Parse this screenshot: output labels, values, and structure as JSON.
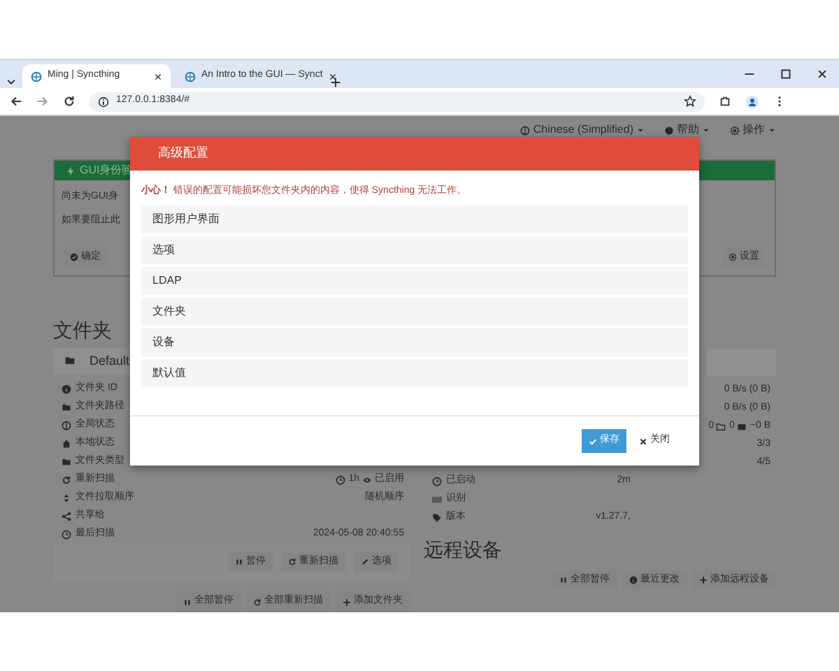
{
  "browser": {
    "tabs": [
      {
        "title": "Ming | Syncthing",
        "selected": true
      },
      {
        "title": "An Intro to the GUI — Synct",
        "selected": false
      }
    ],
    "address": "127.0.0.1:8384/#"
  },
  "navbar": {
    "menus": [
      "Chinese (Simplified)",
      "帮助",
      "操作"
    ]
  },
  "notice": {
    "title": "GUI身份验",
    "lines": [
      "尚未为GUI身",
      "如果要阻止此"
    ],
    "buttons": [
      "确定",
      "设置"
    ]
  },
  "folders": {
    "heading": "文件夹",
    "folder_name": "Default",
    "rows": [
      {
        "label": "文件夹 ID"
      },
      {
        "label": "文件夹路径"
      },
      {
        "label": "全局状态"
      },
      {
        "label": "本地状态"
      },
      {
        "label": "文件夹类型"
      },
      {
        "label": "重新扫描",
        "value": "1h",
        "value_2": "已启用"
      },
      {
        "label": "文件拉取顺序",
        "value": "随机顺序"
      },
      {
        "label": "共享给"
      },
      {
        "label": "最后扫描",
        "value": "2024-05-08 20:40:55"
      }
    ],
    "buttons": [
      "暂停",
      "重新扫描",
      "选项"
    ],
    "footer_buttons": [
      "全部暂停",
      "全部重新扫描",
      "添加文件夹"
    ]
  },
  "device": {
    "rows": [
      {
        "kind": "plain",
        "value": "0 B/s (0 B)"
      },
      {
        "kind": "plain",
        "value": "0 B/s (0 B)"
      },
      {
        "kind": "stats",
        "files": "0",
        "dirs": "0",
        "bytes": "~0 B"
      },
      {
        "kind": "plain",
        "value": "3/3"
      },
      {
        "kind": "plain",
        "value": "4/5"
      },
      {
        "kind": "labeled",
        "label": "已启动",
        "value": "2m"
      },
      {
        "kind": "labeled",
        "label": "识别"
      },
      {
        "kind": "labeled",
        "label": "版本",
        "value": "v1.27.7,"
      }
    ],
    "remote_heading": "远程设备",
    "footer_buttons": [
      "全部暂停",
      "最近更改",
      "添加远程设备"
    ]
  },
  "modal": {
    "title": "高级配置",
    "warning": "**小心！** 错误的配置可能损坏您文件夹内的内容，使得 Syncthing 无法工作。",
    "sections": [
      "图形用户界面",
      "选项",
      "LDAP",
      "文件夹",
      "设备",
      "默认值"
    ],
    "buttons": [
      "保存",
      "关闭"
    ]
  }
}
